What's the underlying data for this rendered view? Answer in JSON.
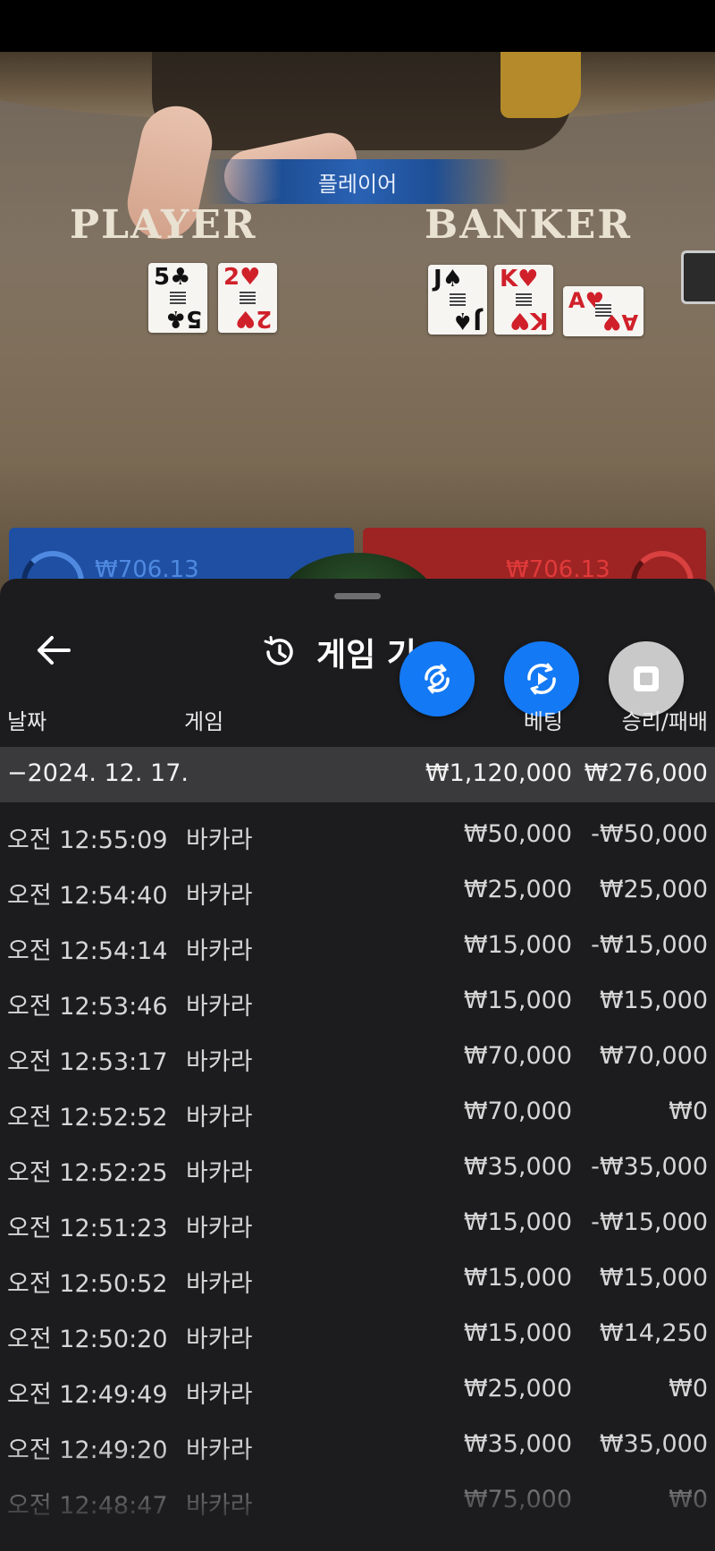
{
  "video": {
    "result_banner": "플레이어",
    "player_label": "PLAYER",
    "banker_label": "BANKER",
    "player_cards": [
      {
        "rank": "5",
        "suit": "♣",
        "color": "black"
      },
      {
        "rank": "2",
        "suit": "♥",
        "color": "red"
      }
    ],
    "banker_cards": [
      {
        "rank": "J",
        "suit": "♠",
        "color": "black"
      },
      {
        "rank": "K",
        "suit": "♥",
        "color": "red"
      },
      {
        "rank": "A",
        "suit": "♥",
        "color": "red"
      }
    ],
    "player_bet_amount": "₩706.13",
    "banker_bet_amount": "₩706.13"
  },
  "history": {
    "title": "게임 기",
    "icons": {
      "back": "arrow-left-icon",
      "history": "history-icon",
      "fab1": "rotate-link-icon",
      "fab2": "replay-icon",
      "fab3": "stop-icon"
    },
    "columns": {
      "date": "날짜",
      "game": "게임",
      "bet": "베팅",
      "result": "승리/패배"
    },
    "day": {
      "date": "−2024. 12. 17.",
      "bet": "₩1,120,000",
      "result": "₩276,000"
    },
    "rows": [
      {
        "time": "오전 12:55:09",
        "game": "바카라",
        "bet": "₩50,000",
        "result": "-₩50,000"
      },
      {
        "time": "오전 12:54:40",
        "game": "바카라",
        "bet": "₩25,000",
        "result": "₩25,000"
      },
      {
        "time": "오전 12:54:14",
        "game": "바카라",
        "bet": "₩15,000",
        "result": "-₩15,000"
      },
      {
        "time": "오전 12:53:46",
        "game": "바카라",
        "bet": "₩15,000",
        "result": "₩15,000"
      },
      {
        "time": "오전 12:53:17",
        "game": "바카라",
        "bet": "₩70,000",
        "result": "₩70,000"
      },
      {
        "time": "오전 12:52:52",
        "game": "바카라",
        "bet": "₩70,000",
        "result": "₩0"
      },
      {
        "time": "오전 12:52:25",
        "game": "바카라",
        "bet": "₩35,000",
        "result": "-₩35,000"
      },
      {
        "time": "오전 12:51:23",
        "game": "바카라",
        "bet": "₩15,000",
        "result": "-₩15,000"
      },
      {
        "time": "오전 12:50:52",
        "game": "바카라",
        "bet": "₩15,000",
        "result": "₩15,000"
      },
      {
        "time": "오전 12:50:20",
        "game": "바카라",
        "bet": "₩15,000",
        "result": "₩14,250"
      },
      {
        "time": "오전 12:49:49",
        "game": "바카라",
        "bet": "₩25,000",
        "result": "₩0"
      },
      {
        "time": "오전 12:49:20",
        "game": "바카라",
        "bet": "₩35,000",
        "result": "₩35,000"
      },
      {
        "time": "오전 12:48:47",
        "game": "바카라",
        "bet": "₩75,000",
        "result": "₩0"
      }
    ]
  }
}
